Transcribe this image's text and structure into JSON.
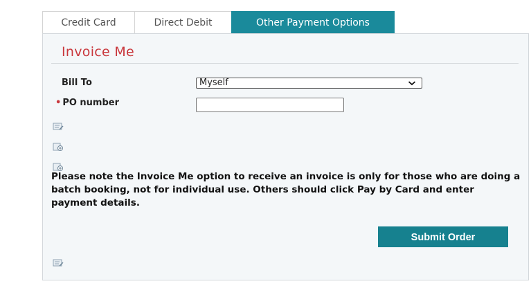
{
  "tabs": [
    {
      "label": "Credit Card",
      "active": false
    },
    {
      "label": "Direct Debit",
      "active": false
    },
    {
      "label": "Other Payment Options",
      "active": true
    }
  ],
  "section": {
    "title": "Invoice Me"
  },
  "form": {
    "bill_to_label": "Bill To",
    "bill_to_value": "Myself",
    "po_required_marker": "•",
    "po_label": "PO number",
    "po_value": ""
  },
  "notice": "Please note the Invoice Me option to receive an invoice is only for those who are doing a batch booking, not for individual use. Others should click Pay by Card and enter payment details.",
  "submit_label": "Submit Order",
  "icons": {
    "note1": "edit-note-icon",
    "note2": "add-note-icon",
    "note3": "add-note-icon",
    "note4": "edit-note-icon"
  },
  "colors": {
    "accent": "#1a8a9b",
    "title_red": "#c9373c",
    "panel_bg": "#f4f7f9"
  }
}
